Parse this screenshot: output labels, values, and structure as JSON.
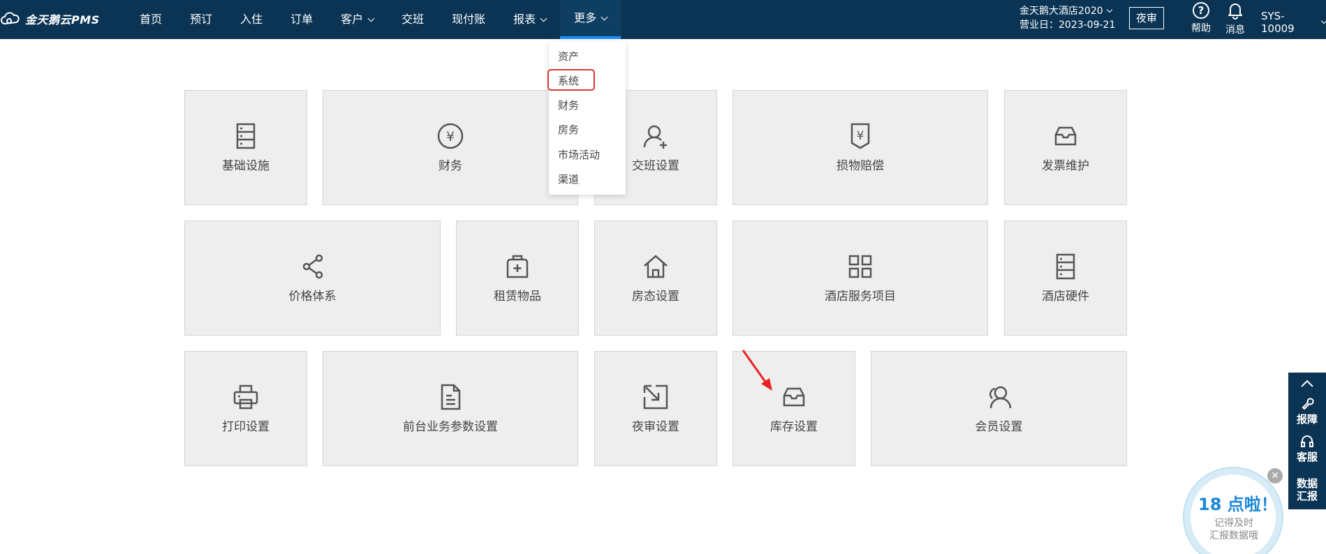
{
  "app": {
    "logo_text": "金天鹅云PMS"
  },
  "nav": {
    "items": [
      {
        "label": "首页",
        "has_dropdown": false
      },
      {
        "label": "预订",
        "has_dropdown": false
      },
      {
        "label": "入住",
        "has_dropdown": false
      },
      {
        "label": "订单",
        "has_dropdown": false
      },
      {
        "label": "客户",
        "has_dropdown": true
      },
      {
        "label": "交班",
        "has_dropdown": false
      },
      {
        "label": "现付账",
        "has_dropdown": false
      },
      {
        "label": "报表",
        "has_dropdown": true
      },
      {
        "label": "更多",
        "has_dropdown": true,
        "active": true
      }
    ]
  },
  "header": {
    "hotel_name": "金天鹅大酒店2020",
    "business_date_label": "营业日：",
    "business_date": "2023-09-21",
    "night_audit_button": "夜审",
    "help_label": "帮助",
    "messages_label": "消息",
    "user": "SYS-10009"
  },
  "dropdown": {
    "items": [
      "资产",
      "系统",
      "财务",
      "房务",
      "市场活动",
      "渠道"
    ],
    "highlighted": "系统"
  },
  "tiles": [
    {
      "label": "基础设施",
      "icon": "server-icon"
    },
    {
      "label": "财务",
      "icon": "yen-circle-icon"
    },
    {
      "label": "交班设置",
      "icon": "user-add-icon"
    },
    {
      "label": "损物赔偿",
      "icon": "yen-shield-icon"
    },
    {
      "label": "发票维护",
      "icon": "inbox-icon"
    },
    {
      "label": "价格体系",
      "icon": "share-icon"
    },
    {
      "label": "租赁物品",
      "icon": "medical-box-icon"
    },
    {
      "label": "房态设置",
      "icon": "home-icon"
    },
    {
      "label": "酒店服务项目",
      "icon": "grid-icon"
    },
    {
      "label": "酒店硬件",
      "icon": "server-icon"
    },
    {
      "label": "打印设置",
      "icon": "printer-icon"
    },
    {
      "label": "前台业务参数设置",
      "icon": "document-icon"
    },
    {
      "label": "夜审设置",
      "icon": "select-arrow-icon"
    },
    {
      "label": "库存设置",
      "icon": "inbox-icon"
    },
    {
      "label": "会员设置",
      "icon": "users-icon"
    }
  ],
  "side_widget": {
    "items": [
      "报障",
      "客服",
      "数据",
      "汇报"
    ]
  },
  "reminder": {
    "title": "18 点啦！",
    "line1": "记得及时",
    "line2": "汇报数据哦"
  },
  "colors": {
    "nav_bg": "#0b3454",
    "active_underline": "#1e90ff",
    "tile_bg": "#eeeeee",
    "highlight_red": "#e03131",
    "reminder_blue": "#1b86d7"
  }
}
